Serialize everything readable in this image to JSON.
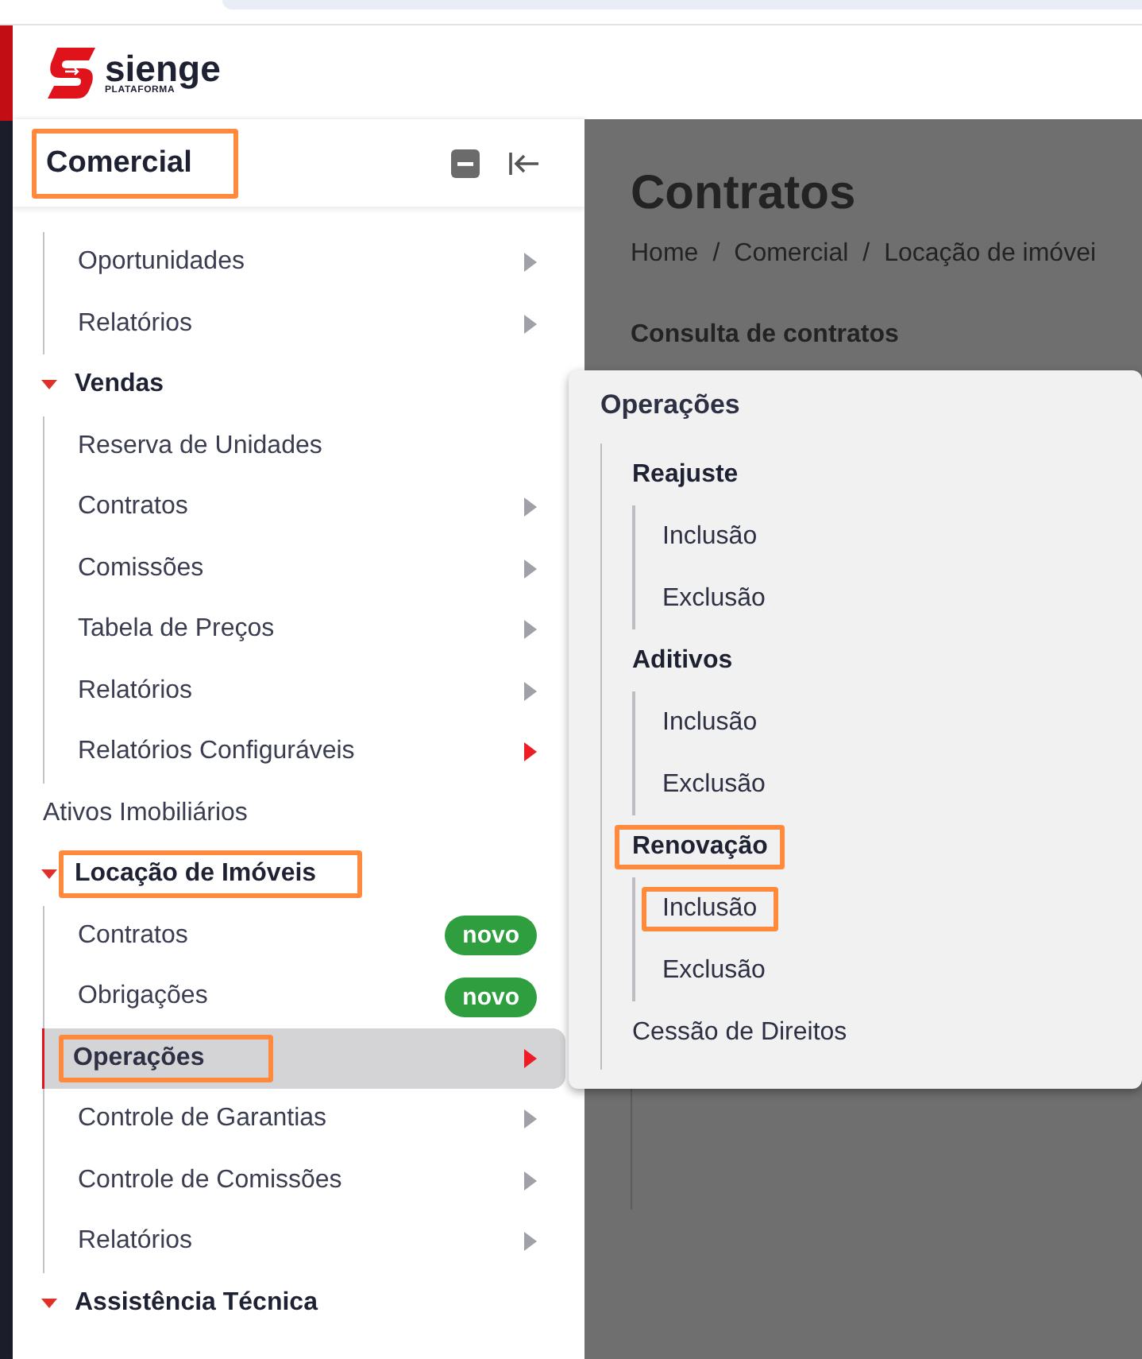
{
  "header": {
    "logo_text": "sienge",
    "logo_subtitle": "PLATAFORMA"
  },
  "sidebar": {
    "title": "Comercial",
    "title_highlighted": true,
    "groups": [
      {
        "expanded": true,
        "children": [
          {
            "label": "Oportunidades",
            "submenu": true,
            "accent": false,
            "selected": false,
            "highlighted": false
          },
          {
            "label": "Relatórios",
            "submenu": true,
            "accent": false,
            "selected": false,
            "highlighted": false
          }
        ]
      },
      {
        "label": "Vendas",
        "kind": "group",
        "expanded": true,
        "highlighted": false,
        "children": [
          {
            "label": "Reserva de Unidades",
            "submenu": false,
            "selected": false,
            "highlighted": false
          },
          {
            "label": "Contratos",
            "submenu": true,
            "accent": false,
            "selected": false,
            "highlighted": false
          },
          {
            "label": "Comissões",
            "submenu": true,
            "accent": false,
            "selected": false,
            "highlighted": false
          },
          {
            "label": "Tabela de Preços",
            "submenu": true,
            "accent": false,
            "selected": false,
            "highlighted": false
          },
          {
            "label": "Relatórios",
            "submenu": true,
            "accent": false,
            "selected": false,
            "highlighted": false
          },
          {
            "label": "Relatórios Configuráveis",
            "submenu": true,
            "accent": true,
            "selected": false,
            "highlighted": false
          }
        ]
      },
      {
        "label": "Ativos Imobiliários",
        "kind": "link",
        "highlighted": false
      },
      {
        "label": "Locação de Imóveis",
        "kind": "group",
        "expanded": true,
        "highlighted": true,
        "children": [
          {
            "label": "Contratos",
            "submenu": false,
            "selected": false,
            "highlighted": false,
            "badge": "novo"
          },
          {
            "label": "Obrigações",
            "submenu": false,
            "selected": false,
            "highlighted": false,
            "badge": "novo"
          },
          {
            "label": "Operações",
            "submenu": true,
            "accent": true,
            "selected": true,
            "highlighted": true
          },
          {
            "label": "Controle de Garantias",
            "submenu": true,
            "accent": false,
            "selected": false,
            "highlighted": false
          },
          {
            "label": "Controle de Comissões",
            "submenu": true,
            "accent": false,
            "selected": false,
            "highlighted": false
          },
          {
            "label": "Relatórios",
            "submenu": true,
            "accent": false,
            "selected": false,
            "highlighted": false
          }
        ]
      },
      {
        "label": "Assistência Técnica",
        "kind": "group",
        "expanded": true,
        "highlighted": false
      }
    ]
  },
  "main": {
    "title": "Contratos",
    "breadcrumb": [
      "Home",
      "Comercial",
      "Locação de imóvei"
    ],
    "breadcrumb_separator": "/",
    "section_title": "Consulta de contratos"
  },
  "flyout": {
    "title": "Operações",
    "items": [
      {
        "kind": "group",
        "label": "Reajuste",
        "highlighted": false,
        "children": [
          {
            "label": "Inclusão",
            "highlighted": false
          },
          {
            "label": "Exclusão",
            "highlighted": false
          }
        ]
      },
      {
        "kind": "group",
        "label": "Aditivos",
        "highlighted": false,
        "children": [
          {
            "label": "Inclusão",
            "highlighted": false
          },
          {
            "label": "Exclusão",
            "highlighted": false
          }
        ]
      },
      {
        "kind": "group",
        "label": "Renovação",
        "highlighted": true,
        "children": [
          {
            "label": "Inclusão",
            "highlighted": true
          },
          {
            "label": "Exclusão",
            "highlighted": false
          }
        ]
      },
      {
        "kind": "link",
        "label": "Cessão de Direitos",
        "highlighted": false
      }
    ]
  }
}
